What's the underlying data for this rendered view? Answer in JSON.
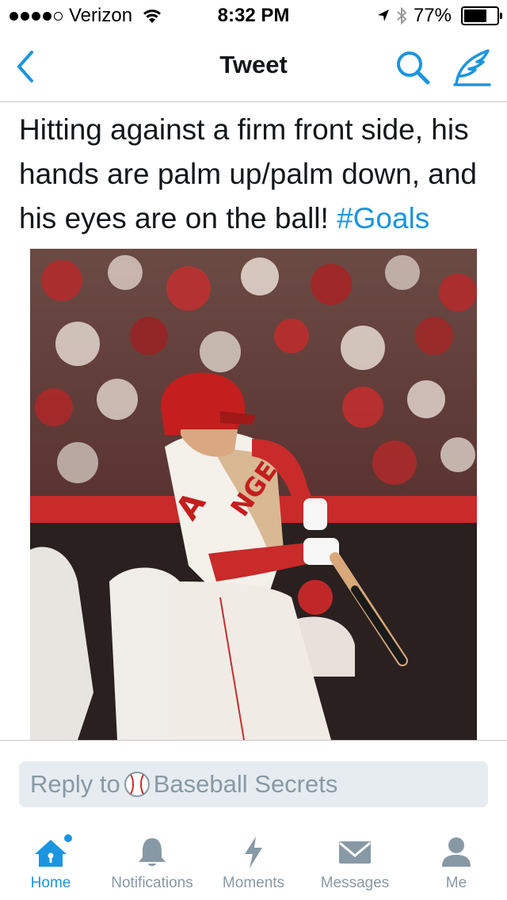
{
  "status_bar": {
    "carrier": "Verizon",
    "time": "8:32 PM",
    "battery_percent": "77%",
    "battery_level": 0.77,
    "signal_bars_filled": 4,
    "signal_bars_total": 5
  },
  "nav": {
    "title": "Tweet",
    "back_icon": "chevron-left-icon",
    "search_icon": "search-icon",
    "compose_icon": "compose-tweet-icon"
  },
  "tweet": {
    "text": "Hitting against a firm front side, his hands are palm up/palm down, and his eyes are on the ball!",
    "hashtag": "#Goals"
  },
  "reply": {
    "prefix": "Reply to",
    "name": "Baseball Secrets"
  },
  "tabs": [
    {
      "label": "Home",
      "icon": "home-icon",
      "active": true
    },
    {
      "label": "Notifications",
      "icon": "bell-icon",
      "active": false
    },
    {
      "label": "Moments",
      "icon": "lightning-icon",
      "active": false
    },
    {
      "label": "Messages",
      "icon": "envelope-icon",
      "active": false
    },
    {
      "label": "Me",
      "icon": "person-icon",
      "active": false
    }
  ],
  "colors": {
    "accent": "#1b95e0",
    "inactive": "#8899a6",
    "reply_background": "#e6ecf0"
  }
}
